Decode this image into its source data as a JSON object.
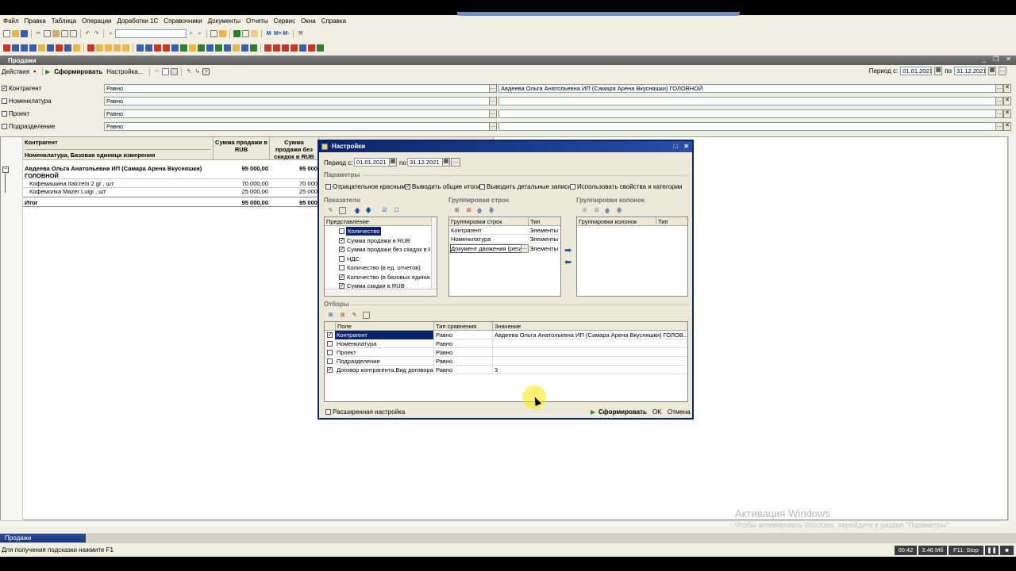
{
  "menu": [
    "Файл",
    "Правка",
    "Таблица",
    "Операции",
    "Доработки 1С",
    "Справочники",
    "Документы",
    "Отчеты",
    "Сервис",
    "Окна",
    "Справка"
  ],
  "doc": {
    "title": "Продажи",
    "toolbar": {
      "actions": "Действия",
      "generate": "Сформировать",
      "settings": "Настройка..."
    },
    "period_from_label": "Период с:",
    "period_from": "01.01.2021",
    "period_to_label": "по",
    "period_to": "31.12.2021"
  },
  "filters": [
    {
      "checked": "✓",
      "name": "Контрагент",
      "cmp": "Равно",
      "value": "Авдеева  Ольга Анатольевна ИП (Самара Арена Вкусняшки) ГОЛОВНОЙ"
    },
    {
      "checked": "",
      "name": "Номенклатура",
      "cmp": "Равно",
      "value": ""
    },
    {
      "checked": "",
      "name": "Проект",
      "cmp": "Равно",
      "value": ""
    },
    {
      "checked": "",
      "name": "Подразделение",
      "cmp": "Равно",
      "value": ""
    }
  ],
  "report": {
    "hdr_col1_line1": "Контрагент",
    "hdr_col1_line2": "Номенклатура, Базовая единица измерения",
    "hdr_col2": "Сумма продажи в RUB",
    "hdr_col3": "Сумма продажи без скидок в RUB",
    "rows": [
      {
        "name": "Авдеева  Ольга Анатольевна ИП (Самара Арена Вкусняшки) ГОЛОВНОЙ",
        "v1": "95 000,00",
        "v2": "95 000,"
      },
      {
        "name": "Кофемашина Italcrem 2 gr , шт",
        "v1": "70 000,00",
        "v2": "70 000,"
      },
      {
        "name": "Кофемолка Mazer Luigi , шт",
        "v1": "25 000,00",
        "v2": "25 000,"
      }
    ],
    "total_label": "Итог",
    "total_v1": "95 000,00",
    "total_v2": "95 000,"
  },
  "dialog": {
    "title": "Настройки",
    "period_from_label": "Период с:",
    "period_from": "01.01.2021",
    "period_to_label": "по",
    "period_to": "31.12.2021",
    "params_label": "Параметры",
    "params": [
      {
        "checked": "",
        "label": "Отрицательное красным"
      },
      {
        "checked": "✓",
        "label": "Выводить общие итоги"
      },
      {
        "checked": "",
        "label": "Выводить детальные записи"
      },
      {
        "checked": "",
        "label": "Использовать свойства и категории"
      }
    ],
    "indicators_label": "Показатели",
    "indicators_header": "Представление",
    "indicators": [
      {
        "checked": "",
        "label": "Количество"
      },
      {
        "checked": "✓",
        "label": "Сумма продажи в RUB"
      },
      {
        "checked": "✓",
        "label": "Сумма продажи без скидок в RUB"
      },
      {
        "checked": "",
        "label": "НДС"
      },
      {
        "checked": "",
        "label": "Количество (в ед. отчетов)"
      },
      {
        "checked": "✓",
        "label": "Количество (в базовых единицах)"
      },
      {
        "checked": "✓",
        "label": "Сумма скидки в RUB"
      }
    ],
    "rowgroups_label": "Группировки строк",
    "rowgroups_header": [
      "Группировки строк",
      "Тип"
    ],
    "rowgroups": [
      {
        "name": "Контрагент",
        "type": "Элементы"
      },
      {
        "name": "Номенклатура",
        "type": "Элементы"
      },
      {
        "name": "Документ движения (регистратор)",
        "type": "Элементы"
      }
    ],
    "colgroups_label": "Группировки колонок",
    "colgroups_header": [
      "Группировки колонок",
      "Тип"
    ],
    "selections_label": "Отборы",
    "selections_header": [
      "Поле",
      "Тип сравнения",
      "Значение"
    ],
    "selections": [
      {
        "checked": "✓",
        "field": "Контрагент",
        "cmp": "Равно",
        "value": "Авдеева  Ольга Анатольевна ИП (Самара Арена Вкусняшки) ГОЛОВ..."
      },
      {
        "checked": "",
        "field": "Номенклатура",
        "cmp": "Равно",
        "value": ""
      },
      {
        "checked": "",
        "field": "Проект",
        "cmp": "Равно",
        "value": ""
      },
      {
        "checked": "",
        "field": "Подразделение",
        "cmp": "Равно",
        "value": ""
      },
      {
        "checked": "✓",
        "field": "Договор контрагента.Вид договора",
        "cmp": "Равно",
        "value": "3"
      }
    ],
    "advanced": "Расширенная настройка",
    "generate": "Сформировать",
    "ok": "OK",
    "cancel": "Отмена"
  },
  "taskbar_item": "Продажи",
  "status_hint": "Для получения подсказки нажмите F1",
  "status": {
    "time": "00:42",
    "mem": "3.46 Мб",
    "f11": "F11: Stop"
  },
  "watermark": {
    "line1": "Активация Windows",
    "line2": "Чтобы активировать Windows, перейдите в раздел \"Параметры\"."
  }
}
